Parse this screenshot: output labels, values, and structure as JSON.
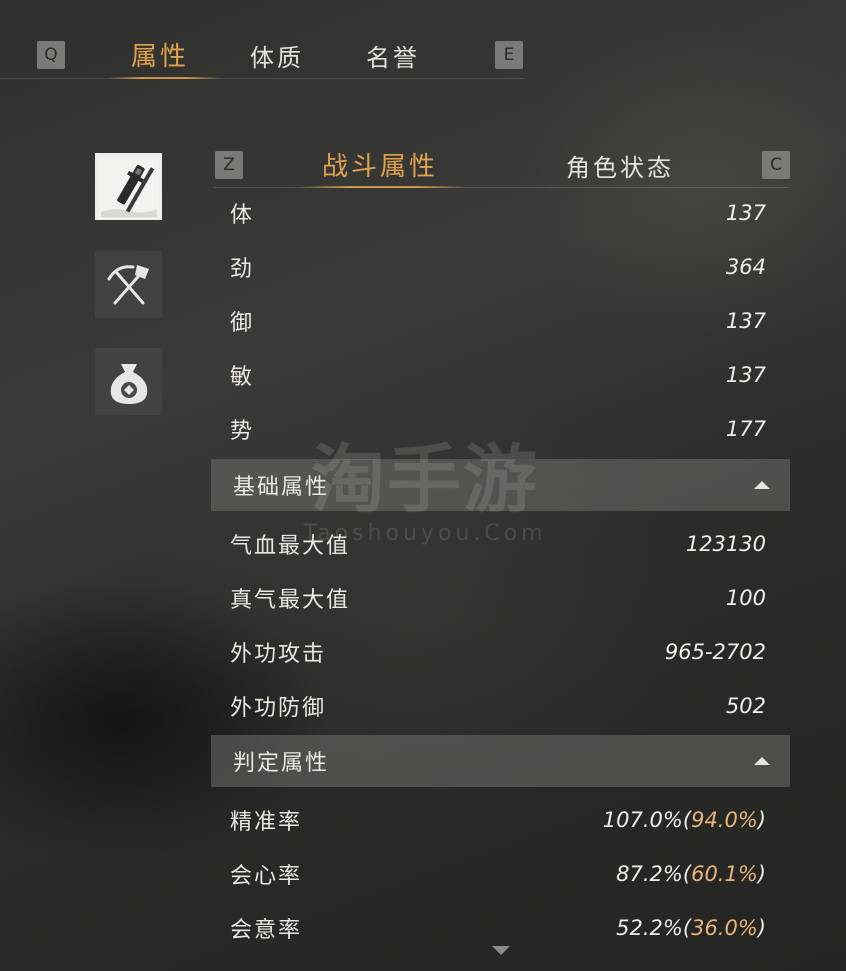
{
  "top_tabs": {
    "key_left": "Q",
    "key_right": "E",
    "items": [
      {
        "label": "属性",
        "active": true
      },
      {
        "label": "体质",
        "active": false
      },
      {
        "label": "名誉",
        "active": false
      }
    ]
  },
  "side_icons": [
    {
      "name": "sword-icon",
      "active": true
    },
    {
      "name": "tools-icon",
      "active": false
    },
    {
      "name": "money-bag-icon",
      "active": false
    }
  ],
  "sub_tabs": {
    "key_left": "Z",
    "key_right": "C",
    "items": [
      {
        "label": "战斗属性",
        "active": true
      },
      {
        "label": "角色状态",
        "active": false
      }
    ]
  },
  "stats_top": [
    {
      "label": "体",
      "value": "137"
    },
    {
      "label": "劲",
      "value": "364"
    },
    {
      "label": "御",
      "value": "137"
    },
    {
      "label": "敏",
      "value": "137"
    },
    {
      "label": "势",
      "value": "177"
    }
  ],
  "basic_section": {
    "title": "基础属性",
    "rows": [
      {
        "label": "气血最大值",
        "value": "123130"
      },
      {
        "label": "真气最大值",
        "value": "100"
      },
      {
        "label": "外功攻击",
        "value": "965-2702"
      },
      {
        "label": "外功防御",
        "value": "502"
      }
    ]
  },
  "judge_section": {
    "title": "判定属性",
    "rows": [
      {
        "label": "精准率",
        "value": "107.0%",
        "alt": "94.0%"
      },
      {
        "label": "会心率",
        "value": "87.2%",
        "alt": "60.1%"
      },
      {
        "label": "会意率",
        "value": "52.2%",
        "alt": "36.0%"
      }
    ]
  },
  "watermark": {
    "main": "淘手游",
    "sub": "Taoshouyou.Com"
  },
  "colors": {
    "accent": "#e1a24e",
    "alt_value": "#e8b47c"
  }
}
